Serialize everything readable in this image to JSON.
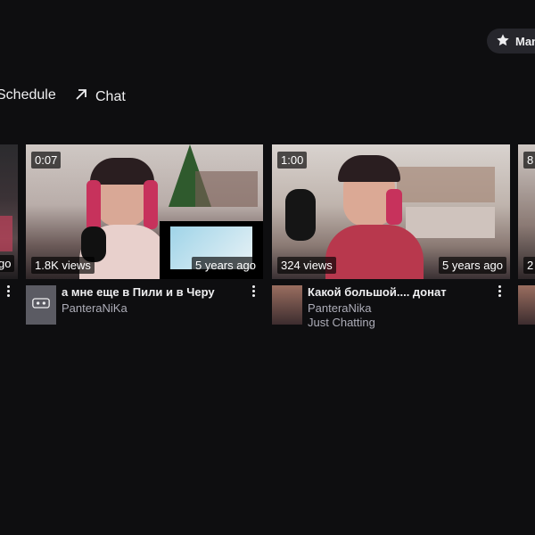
{
  "manage_button": {
    "label": "Man",
    "icon": "star-icon"
  },
  "nav": {
    "schedule_label": "Schedule",
    "chat_label": "Chat"
  },
  "left_partial_card": {
    "overlay": "go"
  },
  "videos": [
    {
      "duration": "0:07",
      "views": "1.8K views",
      "age": "5 years ago",
      "title": "а мне еще в Пили и в Черу",
      "channel": "PanteraNiKa",
      "category": ""
    },
    {
      "duration": "1:00",
      "views": "324 views",
      "age": "5 years ago",
      "title": "Какой большой.... донат",
      "channel": "PanteraNika",
      "category": "Just Chatting"
    }
  ],
  "right_partial_card": {
    "duration": "8",
    "views": "2"
  },
  "colors": {
    "background": "#0e0e10",
    "text": "#efeff1",
    "muted": "#adadb8",
    "button_bg": "#26262c"
  }
}
